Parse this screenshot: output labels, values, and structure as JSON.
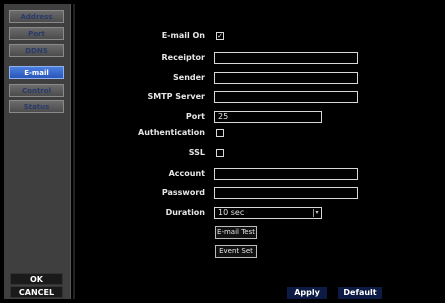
{
  "sidebar": {
    "items": [
      {
        "label": "Address"
      },
      {
        "label": "Port"
      },
      {
        "label": "DDNS"
      },
      {
        "label": "E-mail"
      },
      {
        "label": "Control"
      },
      {
        "label": "Status"
      }
    ],
    "active_index": 3,
    "ok_label": "OK",
    "cancel_label": "CANCEL"
  },
  "form": {
    "email_on": {
      "label": "E-mail On",
      "checked": true
    },
    "receiptor": {
      "label": "Receiptor",
      "value": ""
    },
    "sender": {
      "label": "Sender",
      "value": ""
    },
    "smtp_server": {
      "label": "SMTP Server",
      "value": ""
    },
    "port": {
      "label": "Port",
      "value": "25"
    },
    "authentication": {
      "label": "Authentication",
      "checked": false
    },
    "ssl": {
      "label": "SSL",
      "checked": false
    },
    "account": {
      "label": "Account",
      "value": ""
    },
    "password": {
      "label": "Password",
      "value": ""
    },
    "duration": {
      "label": "Duration",
      "value": "10 sec"
    },
    "email_test_label": "E-mail Test",
    "event_set_label": "Event Set"
  },
  "footer": {
    "apply_label": "Apply",
    "default_label": "Default"
  },
  "colors": {
    "active_tab": "#2f63c8",
    "button_bg": "#0d1a44"
  }
}
